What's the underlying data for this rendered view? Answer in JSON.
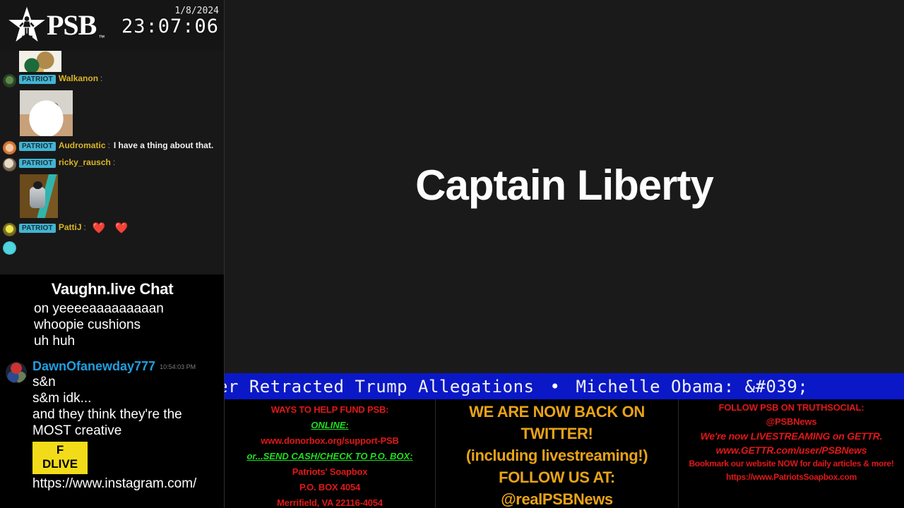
{
  "header": {
    "logo_text": "PSB",
    "logo_tm": "™",
    "logo_icon": "star-silhouette-icon",
    "date": "1/8/2024",
    "time": "23:07:06"
  },
  "patriot_chat": {
    "badge_label": "PATRIOT",
    "messages": [
      {
        "user": "",
        "text": "",
        "has_image": true,
        "image_kind": "cropped-gif-top"
      },
      {
        "user": "Walkanon",
        "text": "",
        "has_image": true,
        "image_kind": "cat-gif"
      },
      {
        "user": "Audromatic",
        "text": "I have a thing about that.",
        "has_image": false
      },
      {
        "user": "ricky_rausch",
        "text": "",
        "has_image": true,
        "image_kind": "robot-dance-gif"
      },
      {
        "user": "PattiJ",
        "text": "",
        "has_image": false,
        "emojis": [
          "❤️",
          "❤️"
        ]
      }
    ]
  },
  "vaughn_chat": {
    "title": "Vaughn.live Chat",
    "caption_lines": [
      "on yeeeeaaaaaaaaan",
      "whoopie cushions",
      "uh huh"
    ],
    "message": {
      "user": "DawnOfanewday777",
      "timestamp": "10:54:03 PM",
      "lines": [
        "s&n",
        "s&m idk...",
        "and they think they're the",
        "MOST creative"
      ],
      "badge_line_1": "F",
      "badge_line_2": "DLIVE",
      "url": "https://www.instagram.com/"
    }
  },
  "main": {
    "caption_title": "Captain Liberty",
    "ticker": {
      "item_1": "er Retracted Trump Allegations",
      "separator": "•",
      "item_2": "Michelle Obama: &#039;"
    }
  },
  "banners": {
    "left": {
      "line_1": "WAYS TO HELP FUND PSB:",
      "line_2": "ONLINE",
      "line_2_tail": ":",
      "line_3": "www.donorbox.org/support-PSB",
      "line_4": "or...SEND CASH/CHECK TO P.O. BOX",
      "line_4_tail": ":",
      "line_5": "Patriots' Soapbox",
      "line_6": "P.O. BOX 4054",
      "line_7": "Merrifield, VA 22116-4054"
    },
    "middle": {
      "line_1": "WE ARE NOW BACK ON TWITTER!",
      "line_2": "(including livestreaming!)",
      "line_3": "FOLLOW US AT:",
      "line_4": "@realPSBNews"
    },
    "right": {
      "line_1": "FOLLOW PSB ON TRUTHSOCIAL:",
      "line_2": "@PSBNews",
      "line_3": "We're now LIVESTREAMING on GETTR.",
      "line_4": "www.GETTR.com/user/PSBNews",
      "line_5": "Bookmark our website NOW for daily articles & more!",
      "line_6": "https://www.PatriotsSoapbox.com"
    }
  },
  "colors": {
    "badge_cyan": "#43b4d2",
    "username_yellow": "#d9b528",
    "ticker_blue": "#0a18c8",
    "banner_red": "#e01818",
    "banner_green": "#21dd21",
    "banner_orange": "#e8a317",
    "dlive_yellow": "#f2dc19",
    "vaughn_name_blue": "#1f9fe0"
  }
}
